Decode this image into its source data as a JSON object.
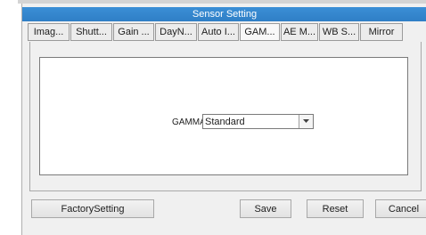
{
  "window": {
    "title": "Sensor Setting"
  },
  "tabs": [
    {
      "label": "Imag..."
    },
    {
      "label": "Shutt..."
    },
    {
      "label": "Gain ..."
    },
    {
      "label": "DayN..."
    },
    {
      "label": "Auto I..."
    },
    {
      "label": "GAM...",
      "active": true
    },
    {
      "label": "AE M..."
    },
    {
      "label": "WB S..."
    },
    {
      "label": "Mirror"
    }
  ],
  "gamma": {
    "label": "GAMMA",
    "selected": "Standard",
    "dropdown_icon": "chevron-down-icon"
  },
  "buttons": {
    "factory_setting": "FactorySetting",
    "save": "Save",
    "reset": "Reset",
    "cancel": "Cancel"
  },
  "colors": {
    "title_bar": "#2f7fc6",
    "window_bg": "#f0f0f0",
    "panel_bg": "#ffffff"
  }
}
